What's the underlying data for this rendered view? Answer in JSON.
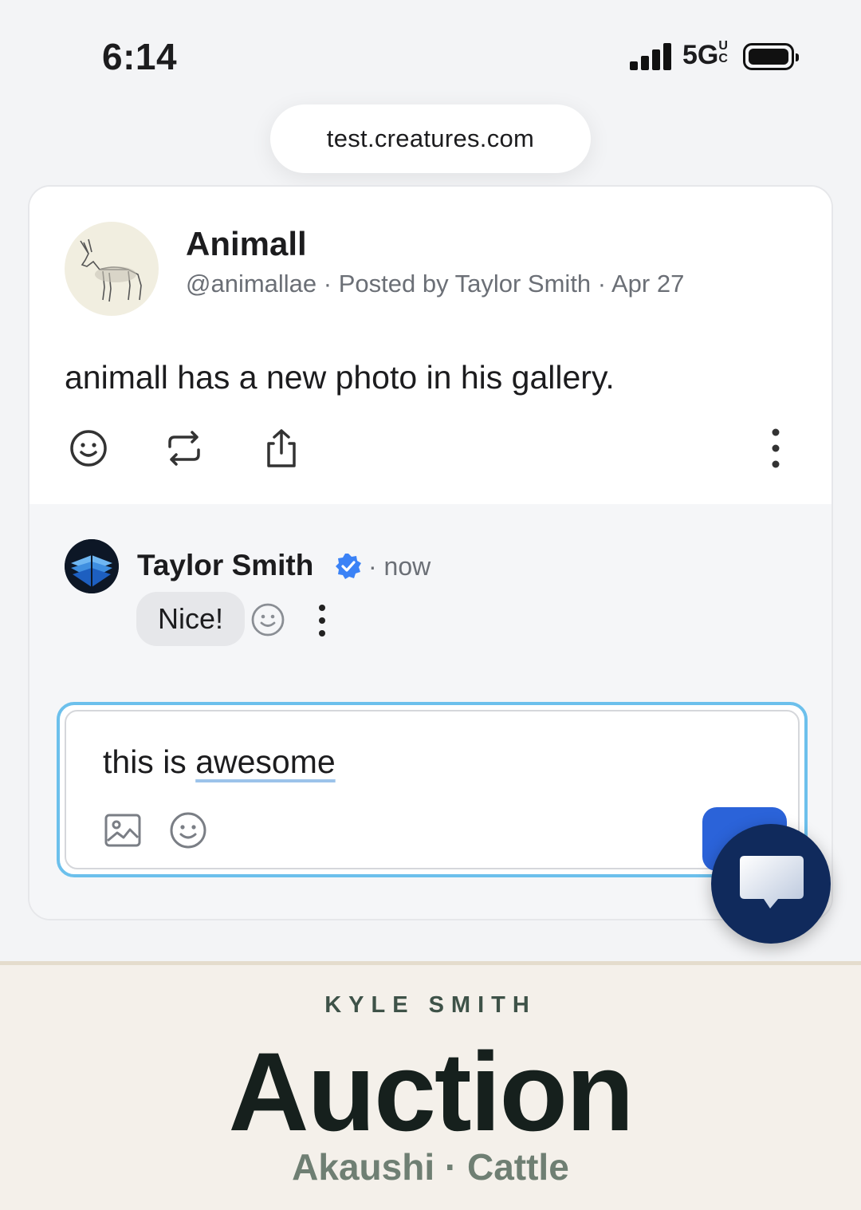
{
  "status_bar": {
    "time": "6:14",
    "network": "5G",
    "network_superscript": "UC"
  },
  "browser": {
    "url": "test.creatures.com"
  },
  "post": {
    "author_name": "Animall",
    "meta": "@animallae · Posted by Taylor Smith · Apr 27",
    "text": "animall has a new photo in his gallery.",
    "actions": [
      "smiley-icon",
      "repost-icon",
      "share-icon",
      "more-vertical-icon"
    ]
  },
  "comment": {
    "author_name": "Taylor Smith",
    "time": "· now",
    "text": "Nice!"
  },
  "composer": {
    "text_plain": "this is ",
    "text_underlined": "awesome"
  },
  "footer": {
    "seller": "KYLE SMITH",
    "title": "Auction",
    "subtitle": "Akaushi · Cattle"
  },
  "colors": {
    "accent": "#2b63d9",
    "focus_ring": "#6cc0ec",
    "fab": "#102a5c",
    "footer_bg": "#f4f0ea",
    "verified": "#3b82f6"
  }
}
